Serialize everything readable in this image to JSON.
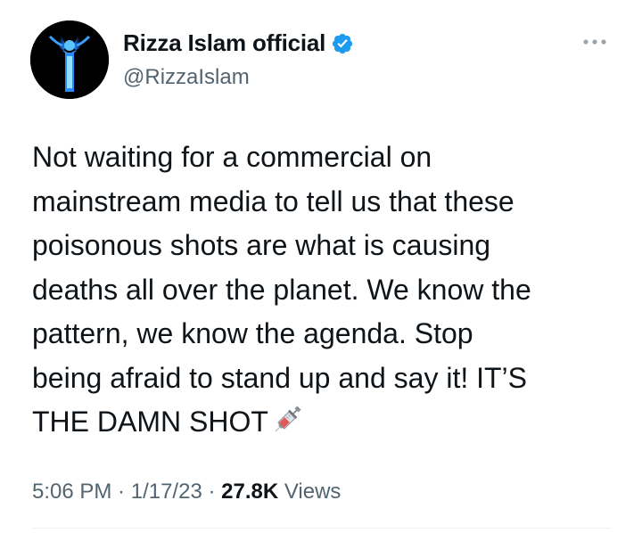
{
  "author": {
    "display_name": "Rizza Islam official",
    "handle": "@RizzaIslam",
    "verified": true,
    "avatar_icon": "avatar-image"
  },
  "tweet": {
    "text": "Not waiting for a commercial on\nmainstream media to tell us that these\npoisonous shots are what is causing\ndeaths all over the planet. We know the\npattern, we know the agenda. Stop\nbeing afraid to stand up and say it! IT’S\nTHE DAMN SHOT",
    "emoji": "syringe-icon"
  },
  "meta": {
    "time": "5:06 PM",
    "sep1": " · ",
    "date": "1/17/23",
    "sep2": " · ",
    "views_count": "27.8K",
    "views_label": " Views"
  },
  "icons": {
    "more": "more-icon",
    "verified": "verified-badge-icon"
  },
  "colors": {
    "text_primary": "#0f1419",
    "text_secondary": "#536471",
    "verified_blue": "#1d9bf0",
    "background": "#ffffff"
  }
}
